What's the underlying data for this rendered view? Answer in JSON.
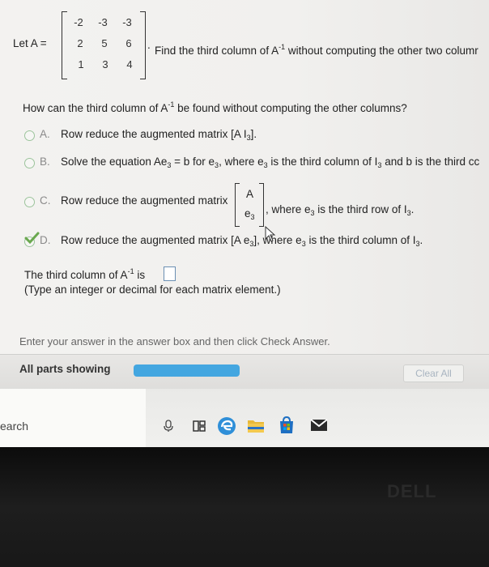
{
  "problem": {
    "let_label": "Let A =",
    "matrix": [
      [
        "-2",
        "-3",
        "-3"
      ],
      [
        "2",
        "5",
        "6"
      ],
      [
        "1",
        "3",
        "4"
      ]
    ],
    "prompt_pre": "Find the third column of A",
    "prompt_sup": "-1",
    "prompt_post": " without computing the other two columr",
    "period": "."
  },
  "question": {
    "pre": "How can the third column of A",
    "sup": "-1",
    "post": " be found without computing the other columns?"
  },
  "options": {
    "a": {
      "letter": "A.",
      "text_pre": "Row reduce the augmented matrix [A I",
      "sub": "3",
      "text_post": "]."
    },
    "b": {
      "letter": "B.",
      "text": "Solve the equation Ae",
      "sub1": "3",
      "t2": " = b for e",
      "sub2": "3",
      "t3": ", where e",
      "sub3": "3",
      "t4": " is the third column of I",
      "sub4": "3",
      "t5": " and b is the third cc"
    },
    "c": {
      "letter": "C.",
      "text": "Row reduce the augmented matrix",
      "m_top": "A",
      "m_bot": "e",
      "m_bot_sub": "3",
      "t2": ", where e",
      "sub2": "3",
      "t3": " is the third row of I",
      "sub3": "3",
      "t4": "."
    },
    "d": {
      "letter": "D.",
      "text": "Row reduce the augmented matrix [A e",
      "sub1": "3",
      "t2": "], where e",
      "sub2": "3",
      "t3": " is the third column of I",
      "sub3": "3",
      "t4": "."
    }
  },
  "answer": {
    "pre": "The third column of A",
    "sup": "-1",
    "post": " is",
    "hint": "(Type an integer or decimal for each matrix element.)"
  },
  "instructions": "Enter your answer in the answer box and then click Check Answer.",
  "status": {
    "parts_label": "All parts showing",
    "clear_label": "Clear All",
    "progress_fraction": 1.0
  },
  "taskbar": {
    "search_label": "earch",
    "icons": [
      "microphone-icon",
      "task-view-icon",
      "edge-icon",
      "file-explorer-icon",
      "store-icon",
      "mail-icon"
    ]
  },
  "bezel": {
    "brand": "DELL"
  },
  "colors": {
    "progress": "#43a6e0",
    "radio_border": "#9cc49c",
    "checkmark": "#6aa84f",
    "answer_box_border": "#6b8fb3",
    "edge_blue": "#2f8fd8",
    "explorer_yellow": "#e8b93a",
    "store_blue": "#2a73c6"
  }
}
